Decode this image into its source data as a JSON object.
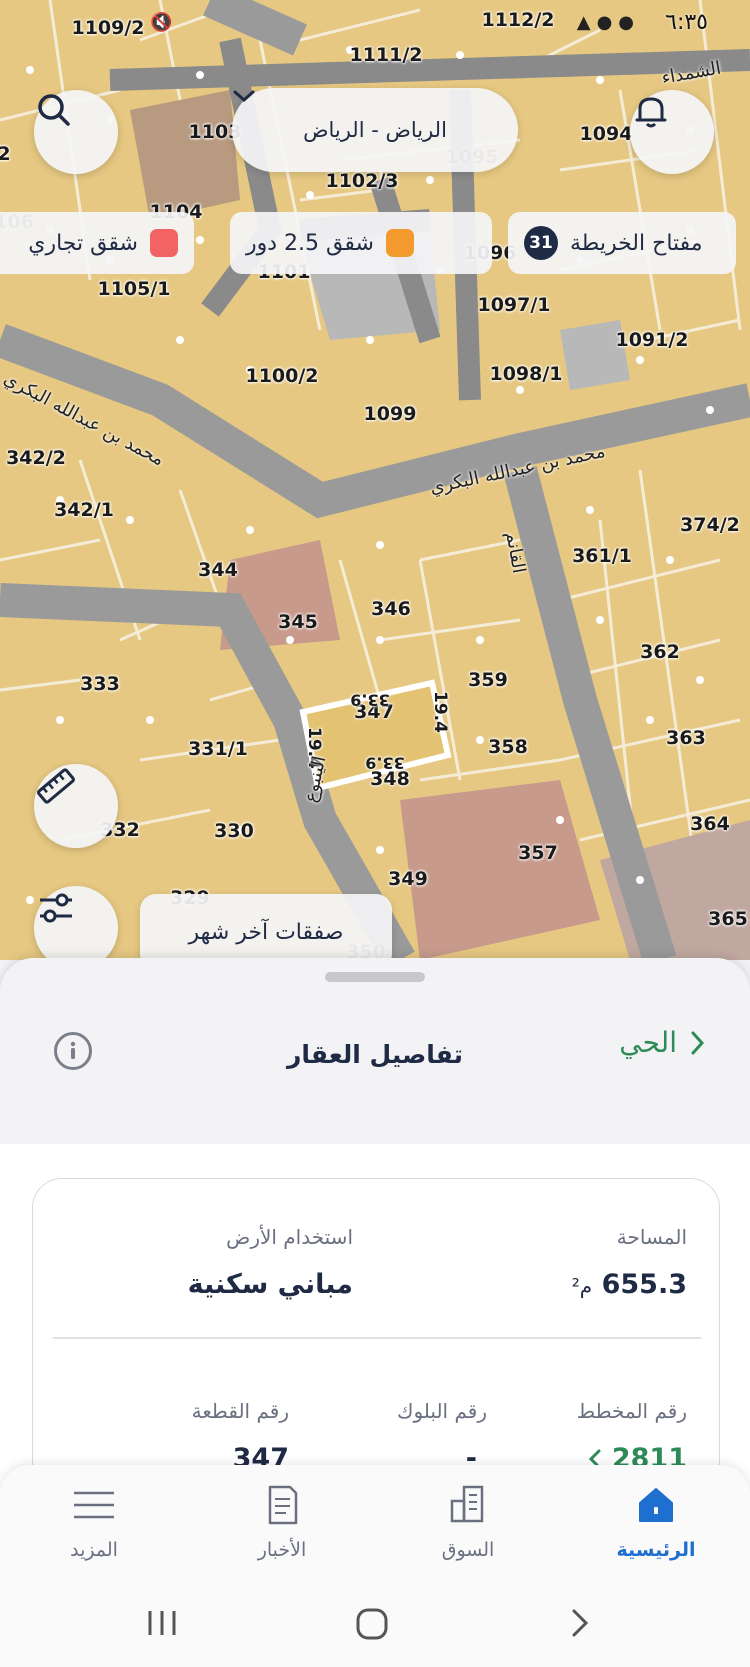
{
  "status_bar": {
    "time": "٦:٣٥"
  },
  "map": {
    "city_selector": {
      "label": "الرياض - الرياض"
    },
    "legend": {
      "key_label": "مفتاح الخريطة",
      "key_count": "31",
      "items": [
        {
          "label": "شقق 2.5 دور",
          "color": "#f29a2e"
        },
        {
          "label": "شقق تجاري",
          "color": "#f26363"
        }
      ]
    },
    "deals_label": "صفقات آخر شهر",
    "streets": {
      "bakri_1": "محمد بن عبدالله البكري",
      "bakri_2": "محمد بن عبدالله البكري",
      "qanem": "القانم",
      "shamdaa": "الشمداء",
      "yanbou": "الينبوع"
    },
    "plot_labels": [
      "1109/2",
      "1112/2",
      "1111/2",
      "1103",
      "1095",
      "1094",
      "1102/3",
      "1104",
      "1101",
      "1096",
      "1105/1",
      "1097/1",
      "1091/2",
      "1100/2",
      "1098/1",
      "1099",
      "342/2",
      "342/1",
      "374/2",
      "361/1",
      "344",
      "345",
      "346",
      "362",
      "333",
      "347",
      "359",
      "331/1",
      "358",
      "363",
      "332",
      "330",
      "348",
      "364",
      "357",
      "349",
      "329",
      "365",
      "106",
      "350",
      "2"
    ],
    "dimensions": [
      "19.4",
      "19.4",
      "33.9",
      "33.9"
    ]
  },
  "sheet": {
    "back_label": "الحي",
    "title": "تفاصيل العقار",
    "fields": {
      "area_label": "المساحة",
      "area_value": "655.3",
      "area_unit": "م²",
      "land_use_label": "استخدام الأرض",
      "land_use_value": "مباني سكنية",
      "plan_label": "رقم المخطط",
      "plan_value": "2811",
      "block_label": "رقم البلوك",
      "block_value": "-",
      "parcel_label": "رقم القطعة",
      "parcel_value": "347"
    }
  },
  "bottom_nav": {
    "items": [
      {
        "label": "الرئيسية",
        "icon": "home-icon",
        "active": true
      },
      {
        "label": "السوق",
        "icon": "buildings-icon",
        "active": false
      },
      {
        "label": "الأخبار",
        "icon": "news-icon",
        "active": false
      },
      {
        "label": "المزيد",
        "icon": "menu-icon",
        "active": false
      }
    ]
  },
  "colors": {
    "accent_green": "#2e8b57",
    "accent_blue": "#1f6fd1",
    "text_dark": "#1f2a44"
  }
}
